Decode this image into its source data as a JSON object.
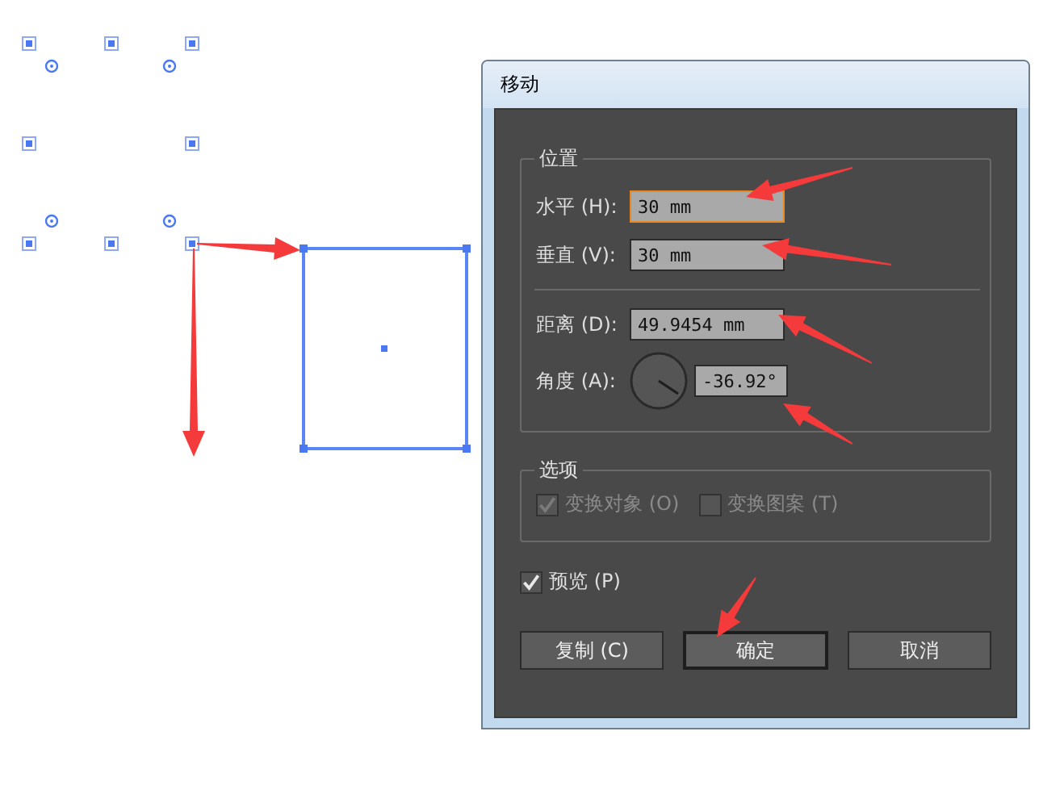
{
  "window": {
    "title": "移动"
  },
  "position_group": {
    "title": "位置",
    "fields": [
      {
        "label": "水平 (H):",
        "value": "30 mm",
        "focused": true
      },
      {
        "label": "垂直 (V):",
        "value": "30 mm",
        "focused": false
      }
    ],
    "distance": {
      "label": "距离 (D):",
      "value": "49.9454 mm"
    },
    "angle": {
      "label": "角度 (A):",
      "value": "-36.92°"
    }
  },
  "options_group": {
    "title": "选项",
    "checkboxes": [
      {
        "label": "变换对象 (O)",
        "checked": true,
        "disabled": true
      },
      {
        "label": "变换图案 (T)",
        "checked": false,
        "disabled": true
      }
    ]
  },
  "preview": {
    "label": "预览 (P)",
    "checked": true
  },
  "buttons": [
    {
      "label": "复制 (C)",
      "default": false
    },
    {
      "label": "确定",
      "default": true
    },
    {
      "label": "取消",
      "default": false
    }
  ]
}
